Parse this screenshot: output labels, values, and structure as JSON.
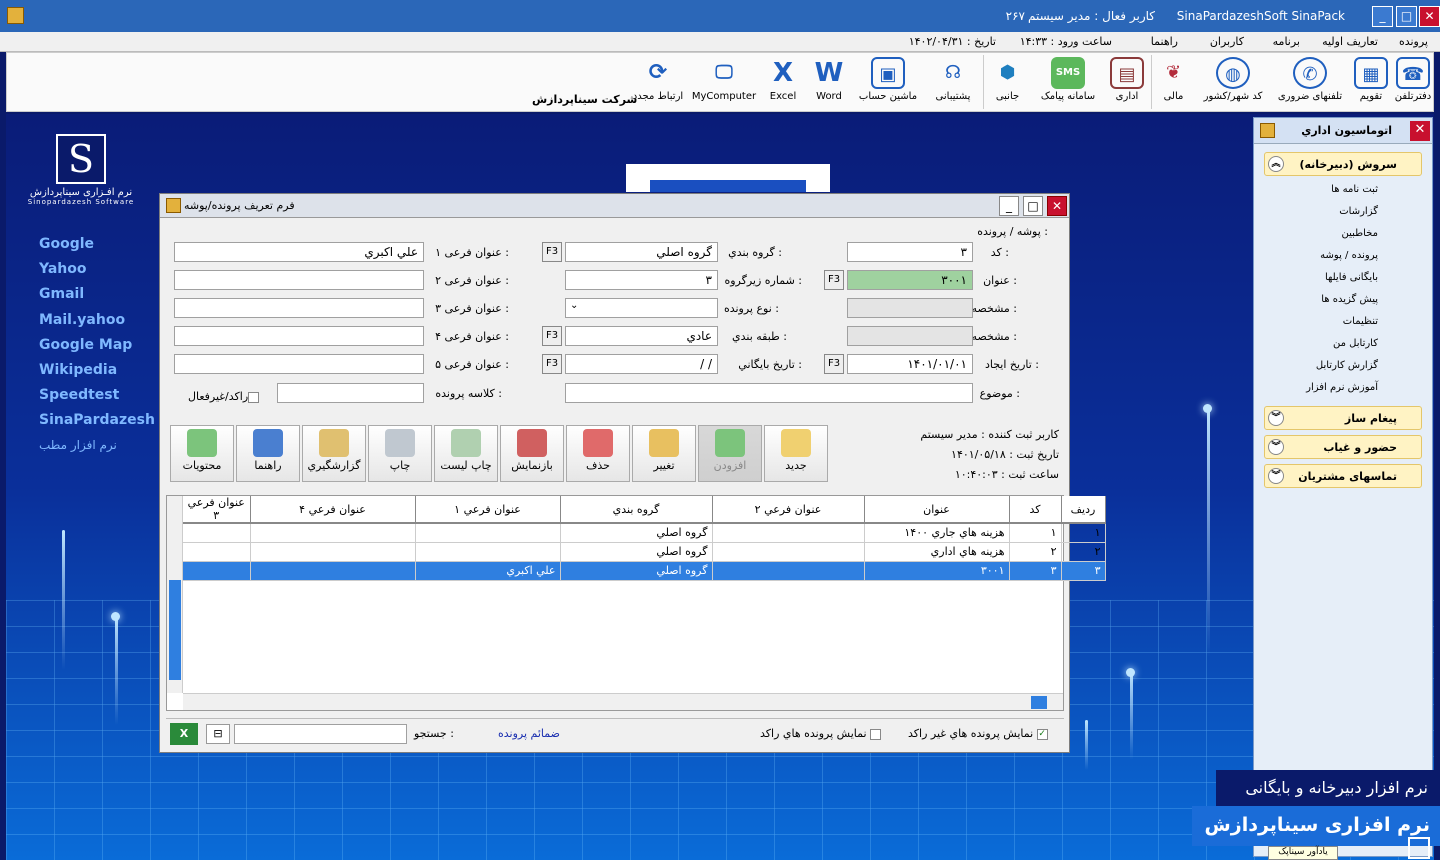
{
  "titlebar": {
    "app_name": "SinaPardazeshSoft SinaPack",
    "active_user": "کاربر فعال : مدير سيستم",
    "code": "۲۶۷",
    "minimize": "_",
    "maximize": "□",
    "close": "✕"
  },
  "menu": {
    "items": [
      "پرونده",
      "تعاریف اولیه",
      "برنامه",
      "کاربران",
      "راهنما"
    ],
    "login_time": "ساعت ورود : ۱۴:۳۳",
    "date": "تاریخ : ۱۴۰۲/۰۴/۳۱"
  },
  "toolbar": {
    "company": "شرکت سیناپردازش",
    "buttons": [
      {
        "label": "دفترتلفن",
        "icon": "phonebook-icon"
      },
      {
        "label": "تقويم",
        "icon": "calendar-icon"
      },
      {
        "label": "تلفنهای ضروری",
        "icon": "phone-icon"
      },
      {
        "label": "کد شهر/کشور",
        "icon": "globe-icon"
      },
      {
        "label": "مالی",
        "icon": "finance-icon"
      },
      {
        "label": "اداری",
        "icon": "office-icon"
      },
      {
        "label": "سامانه پیامک",
        "icon": "sms-icon"
      },
      {
        "label": "جانبی",
        "icon": "box-icon"
      },
      {
        "label": "پشتيبانی",
        "icon": "support-icon"
      },
      {
        "label": "ماشين حساب",
        "icon": "calculator-icon"
      },
      {
        "label": "Word",
        "icon": "word-icon"
      },
      {
        "label": "Excel",
        "icon": "excel-icon"
      },
      {
        "label": "MyComputer",
        "icon": "computer-icon"
      },
      {
        "label": "ارتباط مجدد",
        "icon": "reconnect-icon"
      }
    ]
  },
  "desktop": {
    "logo_line1": "نرم افـزاری سیناپردازش",
    "logo_line2": "Sinopardazesh Software",
    "links": [
      "Google",
      "Yahoo",
      "Gmail",
      "Mail.yahoo",
      "Google Map",
      "Wikipedia",
      "Speedtest",
      "SinaPardazesh",
      "نرم افزار مطب"
    ]
  },
  "side_panel": {
    "title": "اتوماسيون اداري",
    "sections": [
      {
        "title": "سروش (دبيرخانه)",
        "expanded": true,
        "items": [
          "ثبت نامه ها",
          "گزارشات",
          "مخاطبين",
          "پرونده / پوشه",
          "بايگانی فايلها",
          "پيش گزيده ها",
          "تنظيمات",
          "کارتابل من",
          "گزارش کارتابل",
          "آموزش نرم افزار"
        ]
      },
      {
        "title": "پيغام ساز",
        "expanded": false
      },
      {
        "title": "حضور و غياب",
        "expanded": false
      },
      {
        "title": "تماسهای مشتريان",
        "expanded": false
      }
    ]
  },
  "form": {
    "title": "فرم تعريف پرونده/پوشه",
    "breadcrumb": "پوشه / پرونده :",
    "fields": {
      "code": {
        "label": "کد :",
        "value": "۳"
      },
      "title": {
        "label": "عنوان :",
        "value": "۳۰۰۱"
      },
      "spec1": {
        "label": "مشخصه ۱ :",
        "value": ""
      },
      "spec2": {
        "label": "مشخصه ۲ :",
        "value": ""
      },
      "create_date": {
        "label": "تاريخ ايجاد :",
        "value": "۱۴۰۱/۰۱/۰۱"
      },
      "subject": {
        "label": "موضوع :",
        "value": ""
      },
      "group": {
        "label": "گروه بندي :",
        "value": "گروه اصلي"
      },
      "subgroup": {
        "label": "شماره زيرگروه :",
        "value": "۳"
      },
      "file_type": {
        "label": "نوع پرونده :",
        "value": ""
      },
      "classification": {
        "label": "طبقه بندي :",
        "value": "عادي"
      },
      "archive_date": {
        "label": "تاريخ بايگاني :",
        "value": "/ /"
      },
      "file_class": {
        "label": "کلاسه پرونده :",
        "value": ""
      },
      "sub1": {
        "label": "عنوان فرعی ۱ :",
        "value": "علي اکبري"
      },
      "sub2": {
        "label": "عنوان فرعی ۲ :",
        "value": ""
      },
      "sub3": {
        "label": "عنوان فرعی ۳ :",
        "value": ""
      },
      "sub4": {
        "label": "عنوان فرعی ۴ :",
        "value": ""
      },
      "sub5": {
        "label": "عنوان فرعی ۵ :",
        "value": ""
      },
      "stagnant": {
        "label": "راکد/غيرفعال",
        "checked": false
      }
    },
    "f3": "F3",
    "actions": [
      {
        "label": "جديد",
        "icon": "new-icon",
        "enabled": true
      },
      {
        "label": "افزودن",
        "icon": "add-icon",
        "enabled": false
      },
      {
        "label": "تغيير",
        "icon": "edit-icon",
        "enabled": true
      },
      {
        "label": "حذف",
        "icon": "delete-icon",
        "enabled": true
      },
      {
        "label": "بازنمايش",
        "icon": "refresh-icon",
        "enabled": true
      },
      {
        "label": "چاپ ليست",
        "icon": "print-list-icon",
        "enabled": true
      },
      {
        "label": "چاپ",
        "icon": "print-icon",
        "enabled": true
      },
      {
        "label": "گزارشگيري",
        "icon": "report-icon",
        "enabled": true
      },
      {
        "label": "راهنما",
        "icon": "help-icon",
        "enabled": true
      },
      {
        "label": "محتويات",
        "icon": "contents-icon",
        "enabled": true
      }
    ],
    "info": {
      "registrar": "کاربر ثبت کننده : مدير سيستم",
      "reg_date": "تاريخ ثبت : ۱۴۰۱/۰۵/۱۸",
      "reg_time": "ساعت ثبت : ۱۰:۴۰:۰۳"
    },
    "table": {
      "columns": [
        "رديف",
        "کد",
        "عنوان",
        "عنوان فرعي ۲",
        "گروه بندي",
        "عنوان فرعي ۱",
        "عنوان فرعي ۴",
        "عنوان فرعي ۳"
      ],
      "rows": [
        [
          "۱",
          "۱",
          "هزينه هاي جاري ۱۴۰۰",
          "",
          "گروه اصلي",
          "",
          "",
          ""
        ],
        [
          "۲",
          "۲",
          "هزينه هاي اداري",
          "",
          "گروه اصلي",
          "",
          "",
          ""
        ],
        [
          "۳",
          "۳",
          "۳۰۰۱",
          "",
          "گروه اصلي",
          "علي اکبري",
          "",
          ""
        ]
      ],
      "selected_row": 2
    },
    "bottom": {
      "show_active": "نمايش پرونده هاي غير راکد",
      "show_active_checked": true,
      "show_stagnant": "نمايش پرونده هاي راکد",
      "show_stagnant_checked": false,
      "attachments": "ضمائم پرونده",
      "search_label": "جستجو :",
      "search_value": ""
    }
  },
  "banner": {
    "line1": "نرم افزار دبيرخانه و بايگانی",
    "line2": "نرم افزاری سیناپردازش"
  },
  "tooltip": "يادآور سيناپک",
  "colors": {
    "title_blue": "#2b67b8",
    "selection": "#2f7fe0",
    "close_red": "#c8102e"
  }
}
